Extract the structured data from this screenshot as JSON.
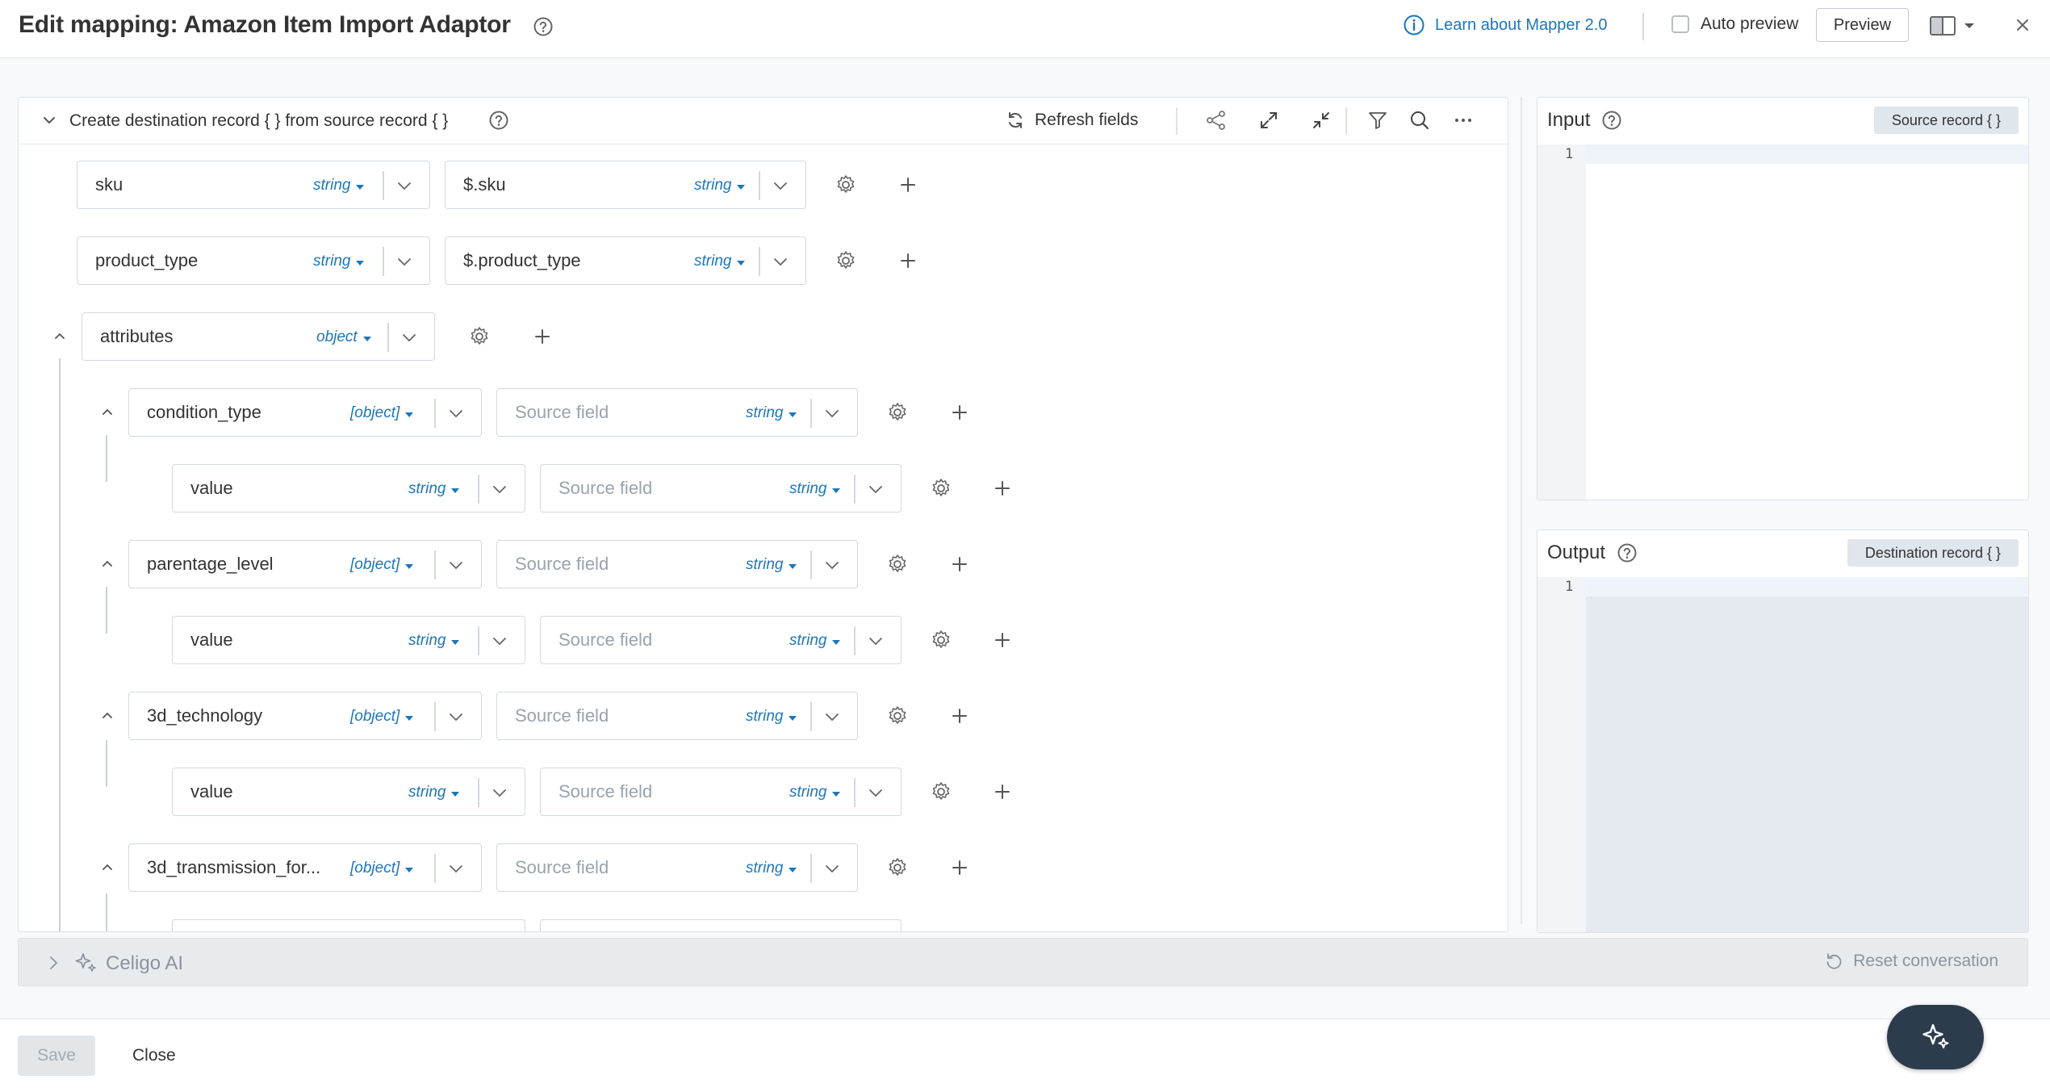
{
  "header": {
    "title": "Edit mapping: Amazon Item Import Adaptor",
    "learn_link": "Learn about Mapper 2.0",
    "auto_preview_label": "Auto preview",
    "preview_label": "Preview"
  },
  "mapper": {
    "toolbar_title": "Create destination record { } from source record { }",
    "refresh_label": "Refresh fields",
    "rows": [
      {
        "dest": "sku",
        "dest_type": "string",
        "source": "$.sku",
        "source_type": "string"
      },
      {
        "dest": "product_type",
        "dest_type": "string",
        "source": "$.product_type",
        "source_type": "string"
      },
      {
        "dest": "attributes",
        "dest_type": "object"
      },
      {
        "dest": "condition_type",
        "dest_type": "[object]",
        "source": "Source field",
        "source_type": "string"
      },
      {
        "dest": "value",
        "dest_type": "string",
        "source": "Source field",
        "source_type": "string"
      },
      {
        "dest": "parentage_level",
        "dest_type": "[object]",
        "source": "Source field",
        "source_type": "string"
      },
      {
        "dest": "value",
        "dest_type": "string",
        "source": "Source field",
        "source_type": "string"
      },
      {
        "dest": "3d_technology",
        "dest_type": "[object]",
        "source": "Source field",
        "source_type": "string"
      },
      {
        "dest": "value",
        "dest_type": "string",
        "source": "Source field",
        "source_type": "string"
      },
      {
        "dest": "3d_transmission_for...",
        "dest_type": "[object]",
        "source": "Source field",
        "source_type": "string"
      }
    ]
  },
  "input_panel": {
    "title": "Input",
    "badge": "Source record { }",
    "line": "1"
  },
  "output_panel": {
    "title": "Output",
    "badge": "Destination record { }",
    "line": "1"
  },
  "ai_bar": {
    "label": "Celigo AI",
    "reset_label": "Reset conversation"
  },
  "footer": {
    "save_label": "Save",
    "close_label": "Close"
  },
  "colors": {
    "accent": "#1d76ba",
    "fab": "#2d3c4d"
  }
}
